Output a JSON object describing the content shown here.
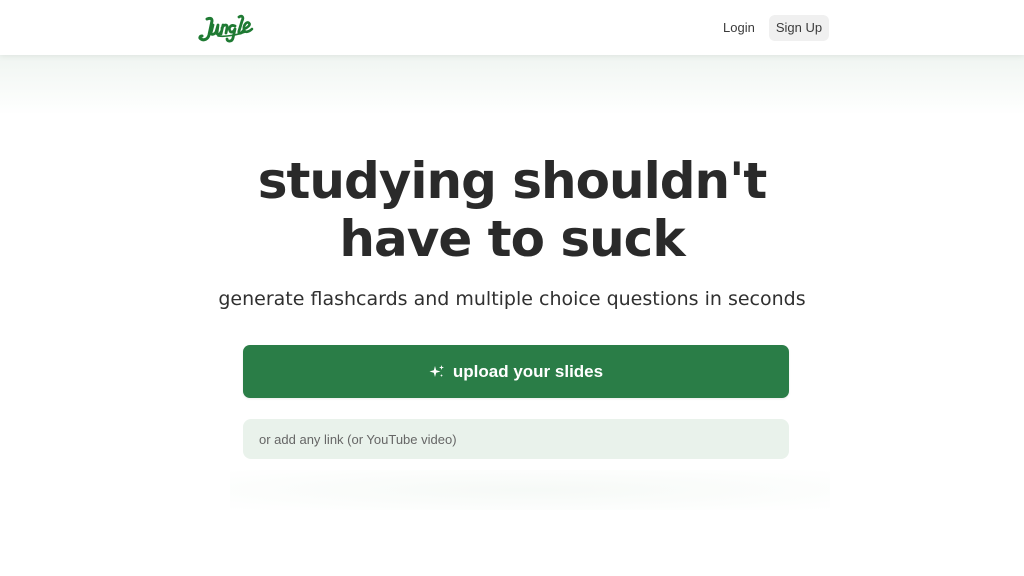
{
  "header": {
    "logo_text": "Jungle",
    "login_label": "Login",
    "signup_label": "Sign Up"
  },
  "hero": {
    "title_line1": "studying shouldn't",
    "title_line2": "have to suck",
    "subtitle": "generate flashcards and multiple choice questions in seconds",
    "upload_label": "upload your slides",
    "upload_icon": "sparkles-icon",
    "link_placeholder": "or add any link (or YouTube video)",
    "link_value": ""
  },
  "colors": {
    "brand_green": "#2a7d47",
    "logo_green": "#1f7a33",
    "input_bg": "#e9f2eb"
  }
}
